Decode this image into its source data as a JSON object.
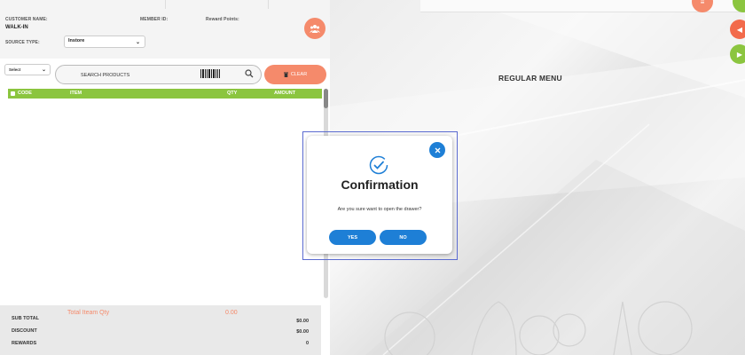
{
  "header": {
    "customer_name_label": "CUSTOMER NAME:",
    "customer_name_value": "WALK-IN",
    "member_id_label": "MEMBER ID:",
    "reward_points_label": "Reward Points:",
    "source_type_label": "SOURCE TYPE:",
    "source_type_value": "Instore"
  },
  "toolbar": {
    "category_select": "Select",
    "search_placeholder": "SEARCH PRODUCTS",
    "clear_label": "CLEAR"
  },
  "table": {
    "columns": [
      "CODE",
      "ITEM",
      "QTY",
      "AMOUNT"
    ]
  },
  "totals": {
    "total_item_qty_label": "Total Iteam Qty",
    "total_item_qty_value": "0.00",
    "sub_total_label": "SUB TOTAL",
    "sub_total_value": "$0.00",
    "discount_label": "DISCOUNT",
    "discount_value": "$0.00",
    "rewards_label": "REWARDS",
    "rewards_value": "0"
  },
  "menu": {
    "title": "REGULAR MENU"
  },
  "dialog": {
    "title": "Confirmation",
    "message": "Are you sure want to open the drawer?",
    "yes_label": "YES",
    "no_label": "NO"
  },
  "colors": {
    "accent_orange": "#f58a6b",
    "accent_green": "#8bc53f",
    "primary_blue": "#1e7fd6"
  },
  "icons": {
    "customer": "users-icon",
    "barcode": "barcode-icon",
    "search": "search-icon",
    "clear": "trash-icon",
    "close": "close-icon",
    "confirm": "check-circle-icon",
    "prev": "caret-left-icon",
    "next": "play-icon"
  }
}
